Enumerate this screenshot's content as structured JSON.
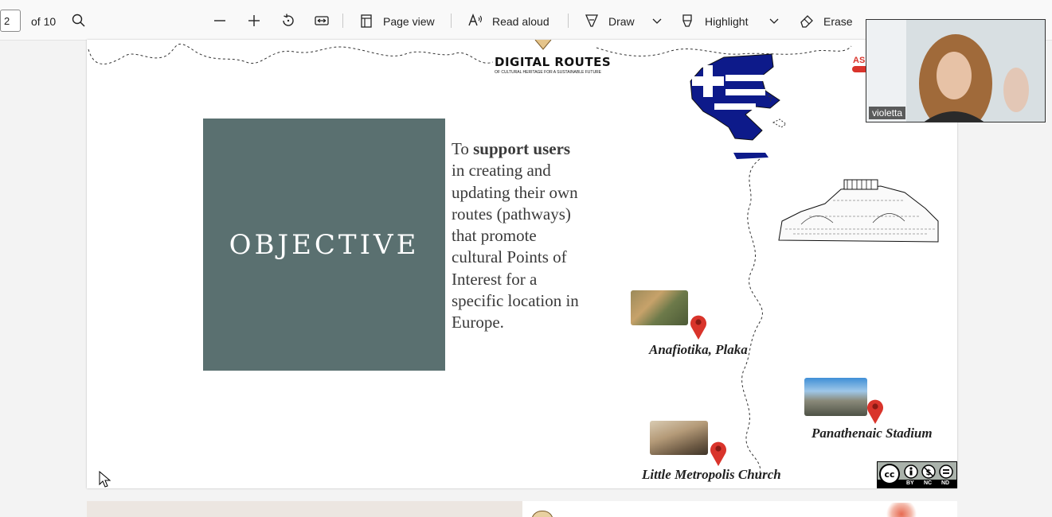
{
  "toolbar": {
    "page_number": "2",
    "page_total": "of 10",
    "page_view_label": "Page view",
    "read_aloud_label": "Read aloud",
    "draw_label": "Draw",
    "highlight_label": "Highlight",
    "erase_label": "Erase"
  },
  "slide": {
    "logo_title": "DIGITAL ROUTES",
    "logo_subtitle": "OF CULTURAL HERITAGE FOR A SUSTAINABLE FUTURE",
    "objective_title": "OBJECTIVE",
    "objective_text_prefix": "To ",
    "objective_text_bold": "support users",
    "objective_text_rest": " in creating and updating their own routes (pathways) that promote cultural Points of Interest for a specific location in Europe.",
    "locations": [
      {
        "caption": "Anafiotika, Plaka"
      },
      {
        "caption": "Panathenaic Stadium"
      },
      {
        "caption": "Little Metropolis Church"
      }
    ],
    "license_labels": [
      "BY",
      "NC",
      "ND"
    ],
    "corner_fragment": "AS"
  },
  "video": {
    "participant_name": "violetta"
  },
  "colors": {
    "objective_box": "#5a7070",
    "pin_red": "#d9342b",
    "greek_blue": "#0d1a8a"
  },
  "icons": [
    "search-icon",
    "zoom-out-icon",
    "zoom-in-icon",
    "rotate-icon",
    "fit-width-icon",
    "page-view-icon",
    "read-aloud-icon",
    "draw-icon",
    "chevron-down-icon",
    "highlight-icon",
    "erase-icon",
    "map-pin-icon",
    "creative-commons-icon",
    "mouse-cursor-icon"
  ]
}
